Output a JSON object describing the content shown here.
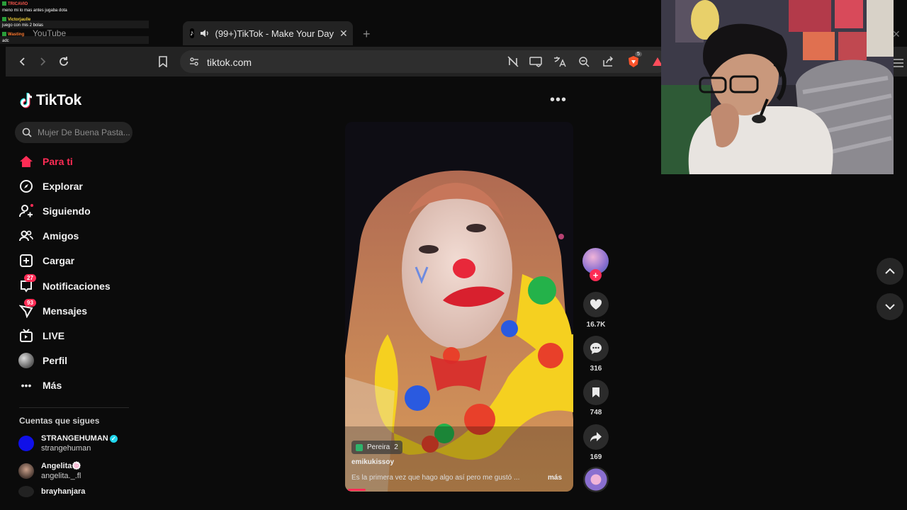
{
  "overlay_chat": {
    "lines": [
      {
        "user": "TRICAVIO",
        "text": "meno mi lo mas antes jugaba dota"
      },
      {
        "user": "Victorjaulle",
        "text": "juego con mis 2 bolas"
      },
      {
        "user": "Wasting",
        "text": "adc"
      }
    ]
  },
  "browser": {
    "inactive_tab": "YouTube",
    "active_tab_title": "(99+)TikTok - Make Your Day",
    "new_tab": "+",
    "url": "tiktok.com",
    "extension_badge": "5"
  },
  "tiktok": {
    "logo_text": "TikTok",
    "search_placeholder": "Mujer De Buena Pasta...",
    "nav": [
      {
        "label": "Para ti",
        "icon": "home-icon"
      },
      {
        "label": "Explorar",
        "icon": "compass-icon"
      },
      {
        "label": "Siguiendo",
        "icon": "following-icon"
      },
      {
        "label": "Amigos",
        "icon": "friends-icon"
      },
      {
        "label": "Cargar",
        "icon": "upload-icon"
      },
      {
        "label": "Notificaciones",
        "icon": "notifications-icon",
        "badge": "27"
      },
      {
        "label": "Mensajes",
        "icon": "messages-icon",
        "badge": "93"
      },
      {
        "label": "LIVE",
        "icon": "live-icon"
      },
      {
        "label": "Perfil",
        "icon": "profile-icon"
      },
      {
        "label": "Más",
        "icon": "more-icon"
      }
    ],
    "following_title": "Cuentas que sigues",
    "accounts": [
      {
        "name": "STRANGEHUMAN",
        "handle": "strangehuman",
        "verified": true
      },
      {
        "name": "Angelita🍥",
        "handle": "angelita._.fl"
      },
      {
        "name": "brayhanjara",
        "handle": ""
      }
    ],
    "video": {
      "location": "Pereira",
      "location_count": "2",
      "creator": "emikukissoy",
      "caption": "Es la primera vez que hago algo así pero me gustó ...",
      "more": "más",
      "progress": 0.08
    },
    "actions": {
      "likes": "16.7K",
      "comments": "316",
      "saves": "748",
      "shares": "169"
    }
  },
  "colors": {
    "accent": "#fe2c55",
    "verified": "#20d5ec",
    "background": "#0b0b0b"
  }
}
